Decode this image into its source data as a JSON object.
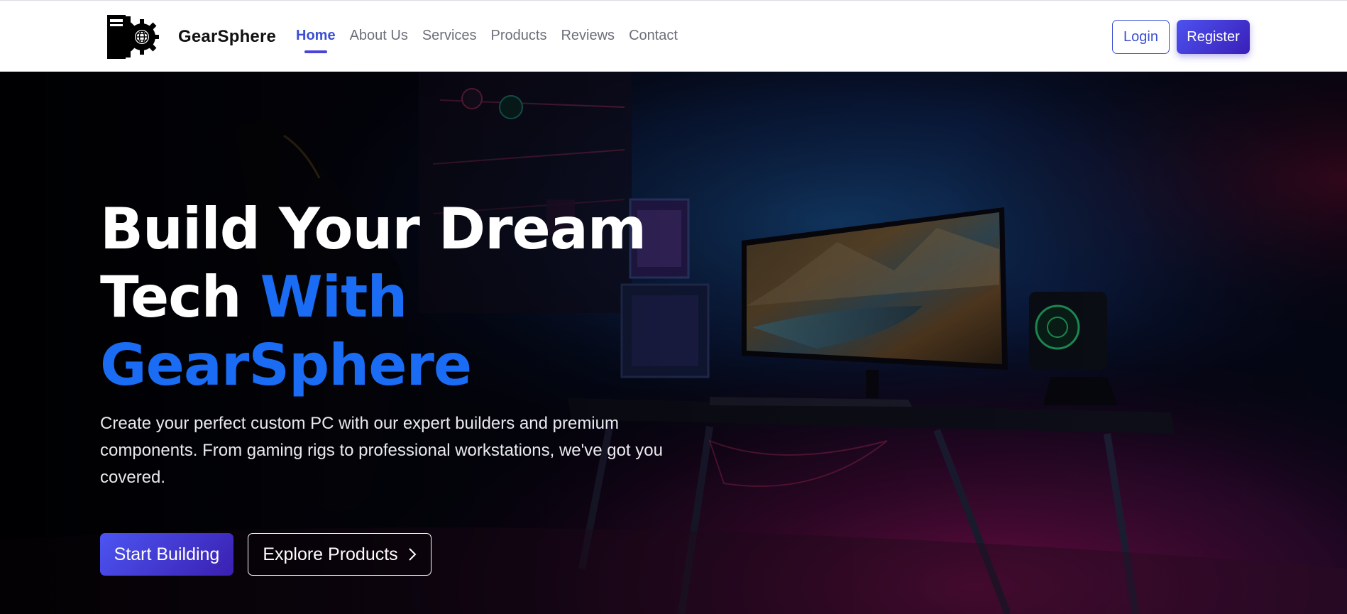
{
  "brand": {
    "name": "GearSphere",
    "logo_icon": "pc-tower-gear-globe-icon"
  },
  "nav": {
    "items": [
      {
        "label": "Home",
        "active": true
      },
      {
        "label": "About Us",
        "active": false
      },
      {
        "label": "Services",
        "active": false
      },
      {
        "label": "Products",
        "active": false
      },
      {
        "label": "Reviews",
        "active": false
      },
      {
        "label": "Contact",
        "active": false
      }
    ],
    "login_label": "Login",
    "register_label": "Register"
  },
  "hero": {
    "title_line1": "Build Your Dream",
    "title_line2_white": "Tech ",
    "title_line2_accent": "With",
    "title_line3_accent": "GearSphere",
    "description": "Create your perfect custom PC with our expert builders and premium components. From gaming rigs to professional workstations, we've got you covered.",
    "start_label": "Start Building",
    "explore_label": "Explore Products",
    "explore_icon": "chevron-right-icon",
    "background": "gaming-room-desk-monitor-image"
  },
  "colors": {
    "accent": "#1a6cf4",
    "primary": "#3b4fd4",
    "button_gradient_start": "#4d52f0",
    "button_gradient_end": "#3a1fb8"
  }
}
